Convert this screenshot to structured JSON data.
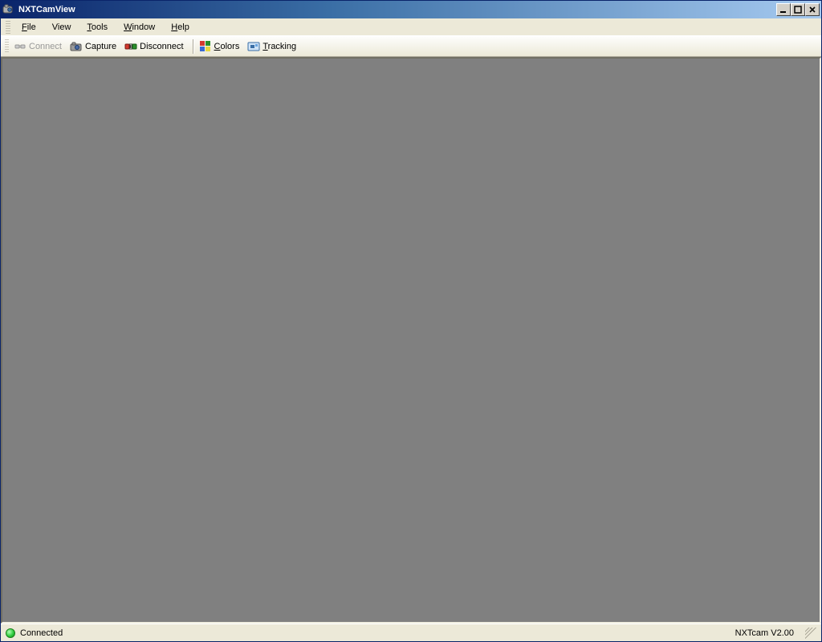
{
  "titlebar": {
    "title": "NXTCamView"
  },
  "menu": {
    "file": "File",
    "view": "View",
    "tools": "Tools",
    "window": "Window",
    "help": "Help"
  },
  "toolbar": {
    "connect": "Connect",
    "capture": "Capture",
    "disconnect": "Disconnect",
    "colors": "Colors",
    "tracking": "Tracking"
  },
  "status": {
    "connection": "Connected",
    "version": "NXTcam V2.00"
  },
  "colors": {
    "titlebar_start": "#0a246a",
    "titlebar_end": "#a6caf0",
    "chrome": "#ece9d8",
    "workspace": "#808080",
    "status_ok": "#2ecc40"
  }
}
